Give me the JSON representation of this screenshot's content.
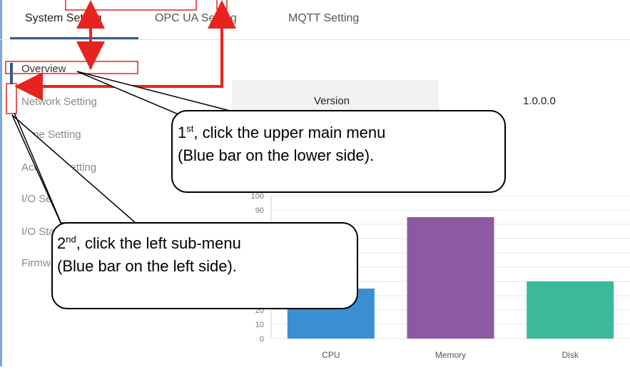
{
  "tabs": [
    {
      "label": "System Setting"
    },
    {
      "label": "OPC UA Setting"
    },
    {
      "label": "MQTT Setting"
    }
  ],
  "sidebar": {
    "items": [
      {
        "label": "Overview"
      },
      {
        "label": "Network Setting"
      },
      {
        "label": "Time Setting"
      },
      {
        "label": "Account Setting"
      },
      {
        "label": "I/O Setting"
      },
      {
        "label": "I/O Status"
      },
      {
        "label": "Firmware Update"
      }
    ]
  },
  "info": {
    "version_label": "Version",
    "version_value": "1.0.0.0"
  },
  "colors": {
    "accent": "#2d5b8b",
    "annotation_red": "#e8231f",
    "cpu_bar": "#3a8fd3",
    "memory_bar": "#8b5aa2",
    "disk_bar": "#3cb89a"
  },
  "callouts": {
    "first": {
      "num": "1",
      "sup": "st",
      "line1_rest": ", click the upper main menu",
      "line2": "(Blue bar on the lower side)."
    },
    "second": {
      "num": "2",
      "sup": "nd",
      "line1_rest": ", click the left sub-menu",
      "line2": "(Blue bar on the left side)."
    }
  },
  "chart_data": {
    "type": "bar",
    "categories": [
      "CPU",
      "Memory",
      "Disk"
    ],
    "values": [
      35,
      85,
      40
    ],
    "ylim": [
      0,
      100
    ],
    "yticks": [
      "0",
      "10",
      "20",
      "30",
      "40",
      "50",
      "60",
      "70",
      "80",
      "90",
      "100"
    ],
    "colors": [
      "#3a8fd3",
      "#8b5aa2",
      "#3cb89a"
    ],
    "grid": true
  }
}
